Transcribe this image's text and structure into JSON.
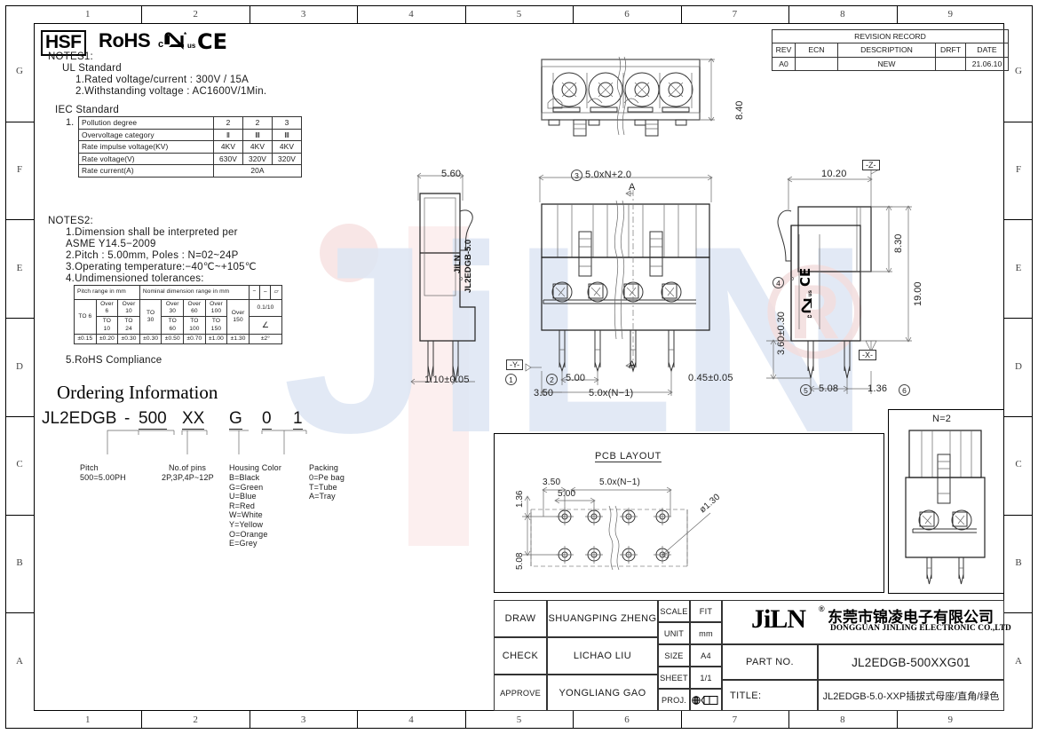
{
  "sheet": {
    "zones_top": [
      "1",
      "2",
      "3",
      "4",
      "5",
      "6",
      "7",
      "8",
      "9"
    ],
    "zones_bottom": [
      "1",
      "2",
      "3",
      "4",
      "5",
      "6",
      "7",
      "8",
      "9"
    ],
    "zones_left": [
      "G",
      "F",
      "E",
      "D",
      "C",
      "B",
      "A"
    ],
    "zones_right": [
      "G",
      "F",
      "E",
      "D",
      "C",
      "B",
      "A"
    ]
  },
  "compliance": {
    "hsf": "HSF",
    "rohs": "RoHS",
    "ul_c": "c",
    "ul_us": "us",
    "ul_star": "*",
    "ce": "CE"
  },
  "notes1": {
    "heading": "NOTES1:",
    "subheading": "UL Standard",
    "items": [
      "1.Rated voltage/current : 300V / 15A",
      "2.Withstanding voltage : AC1600V/1Min."
    ],
    "iec_heading": "IEC Standard",
    "iec_index": "1.",
    "iec_table": {
      "rows": [
        {
          "label": "Pollution degree",
          "c1": "2",
          "c2": "2",
          "c3": "3"
        },
        {
          "label": "Overvoltage category",
          "c1": "Ⅱ",
          "c2": "Ⅲ",
          "c3": "Ⅲ"
        },
        {
          "label": "Rate impulse voltage(KV)",
          "c1": "4KV",
          "c2": "4KV",
          "c3": "4KV"
        },
        {
          "label": "Rate voltage(V)",
          "c1": "630V",
          "c2": "320V",
          "c3": "320V"
        }
      ],
      "last_row_label": "Rate current(A)",
      "last_row_value": "20A"
    }
  },
  "notes2": {
    "heading": "NOTES2:",
    "items": [
      "1.Dimension shall be interpreted per",
      "  ASME Y14.5−2009",
      "2.Pitch : 5.00mm, Poles : N=02~24P",
      "3.Operating temperature:−40℃~+105℃",
      "4.Undimensioned tolerances:"
    ],
    "item5": "5.RoHS Compliance",
    "tol_table": {
      "head_left": "Pitch range in mm",
      "head_mid": "Nominal dimension range in mm",
      "sym_minus": "−",
      "sym_arc": "⌢",
      "sym_par": "▱",
      "pitch_cols": [
        "",
        "Over 6 TO 10",
        "Over 10 TO 24"
      ],
      "pitch_first_to": "TO 6",
      "nominal_cols": [
        "TO 30",
        "Over 30 TO 60",
        "Over 60 TO 100",
        "Over 100 TO 150",
        "Over 150"
      ],
      "tolerances": [
        "±0.15",
        "±0.20",
        "±0.30",
        "±0.30",
        "±0.50",
        "±0.70",
        "±1.00",
        "±1.30"
      ],
      "right_val_top": "0.1/10",
      "right_sym_mid": "∠",
      "right_val_bot": "±2°"
    }
  },
  "ordering": {
    "title": "Ordering Information",
    "code_parts": [
      "JL2EDGB",
      "-",
      "500",
      "XX",
      "G",
      "0",
      "1"
    ],
    "pitch": {
      "title": "Pitch",
      "value": "500=5.00PH"
    },
    "pins": {
      "title": "No.of pins",
      "value": "2P,3P,4P~12P"
    },
    "housing": {
      "title": "Housing Color",
      "options": [
        "B=Black",
        "G=Green",
        "U=Blue",
        "R=Red",
        "W=White",
        "Y=Yellow",
        "O=Orange",
        "E=Grey"
      ]
    },
    "packing": {
      "title": "Packing",
      "options": [
        "0=Pe bag",
        "T=Tube",
        "A=Tray"
      ]
    }
  },
  "revision": {
    "title": "REVISION RECORD",
    "headers": [
      "REV",
      "ECN",
      "DESCRIPTION",
      "DRFT",
      "DATE"
    ],
    "rows": [
      {
        "rev": "A0",
        "ecn": "",
        "description": "NEW",
        "drft": "",
        "date": "21.06.10"
      }
    ]
  },
  "views": {
    "top_view": {
      "height_dim": "8.40"
    },
    "side_view": {
      "width_dim": "5.60",
      "brand_line1": "JiLN",
      "brand_line2": "JL2EDGB-5.0",
      "pin_dim": "1.10±0.05",
      "callout": "1"
    },
    "front_view": {
      "overall": "5.0xN+2.0",
      "overall_callout": "3",
      "section_mark": "A",
      "pitch": "5.00",
      "pitch_callout": "2",
      "edge": "3.50",
      "span": "5.0x(N−1)",
      "pin_thickness": "0.45±0.05",
      "datum_y": "-Y-"
    },
    "end_view": {
      "depth": "10.20",
      "upper_height": "8.30",
      "total_height": "19.00",
      "pin_length": "3.60±0.30",
      "pin_length_callout": "4",
      "pin_pitch": "5.08",
      "pin_pitch_callout": "5",
      "offset": "1.36",
      "offset_callout": "6",
      "datum_z": "-Z-",
      "datum_x": "-X-",
      "ul_c": "c",
      "ul_us": "us",
      "ce": "CE"
    },
    "pcb_layout": {
      "title": "PCB LAYOUT",
      "edge": "3.50",
      "pitch": "5.00",
      "span": "5.0x(N−1)",
      "row_gap": "5.08",
      "top_off": "1.36",
      "hole": "ø1.30"
    },
    "n2_view": {
      "label": "N=2"
    }
  },
  "title_block": {
    "draw_label": "DRAW",
    "draw_value": "SHUANGPING ZHENG",
    "check_label": "CHECK",
    "check_value": "LICHAO  LIU",
    "approve_label": "APPROVE",
    "approve_value": "YONGLIANG GAO",
    "scale_label": "SCALE",
    "scale_value": "FIT",
    "unit_label": "UNIT",
    "unit_value": "mm",
    "size_label": "SIZE",
    "size_value": "A4",
    "sheet_label": "SHEET",
    "sheet_value": "1/1",
    "proj_label": "PROJ.",
    "company_logo": "JiLN",
    "company_reg": "®",
    "company_cn": "东莞市锦凌电子有限公司",
    "company_en": "DONGGUAN JINLING ELECTRONIC CO.,LTD",
    "part_label": "PART NO.",
    "part_value": "JL2EDGB-500XXG01",
    "title_label": "TITLE:",
    "title_value": "JL2EDGB-5.0-XXP插拔式母座/直角/绿色"
  }
}
